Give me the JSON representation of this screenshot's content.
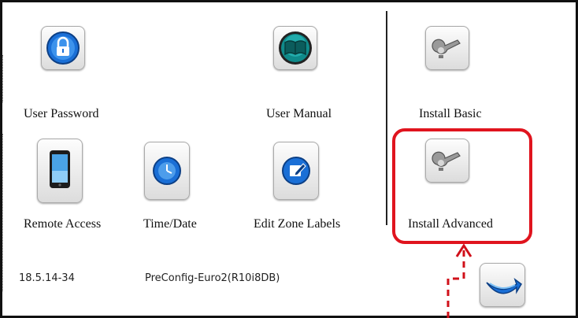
{
  "menu": {
    "items": [
      {
        "id": "user_password",
        "label": "User Password",
        "icon": "lock-icon"
      },
      {
        "id": "user_manual",
        "label": "User Manual",
        "icon": "book-icon"
      },
      {
        "id": "install_basic",
        "label": "Install Basic",
        "icon": "wrench-icon"
      },
      {
        "id": "remote_access",
        "label": "Remote Access",
        "icon": "phone-icon"
      },
      {
        "id": "time_date",
        "label": "Time/Date",
        "icon": "clock-icon"
      },
      {
        "id": "edit_zone_labels",
        "label": "Edit Zone Labels",
        "icon": "edit-icon"
      },
      {
        "id": "install_advanced",
        "label": "Install Advanced",
        "icon": "wrench-icon"
      }
    ]
  },
  "footer": {
    "version": "18.5.14-34",
    "config": "PreConfig-Euro2(R10i8DB)"
  },
  "colors": {
    "highlight": "#e0141e",
    "icon_blue": "#1a6fd6",
    "icon_teal": "#0f8a8a"
  },
  "back_button": {
    "icon": "back-arrow-icon"
  }
}
